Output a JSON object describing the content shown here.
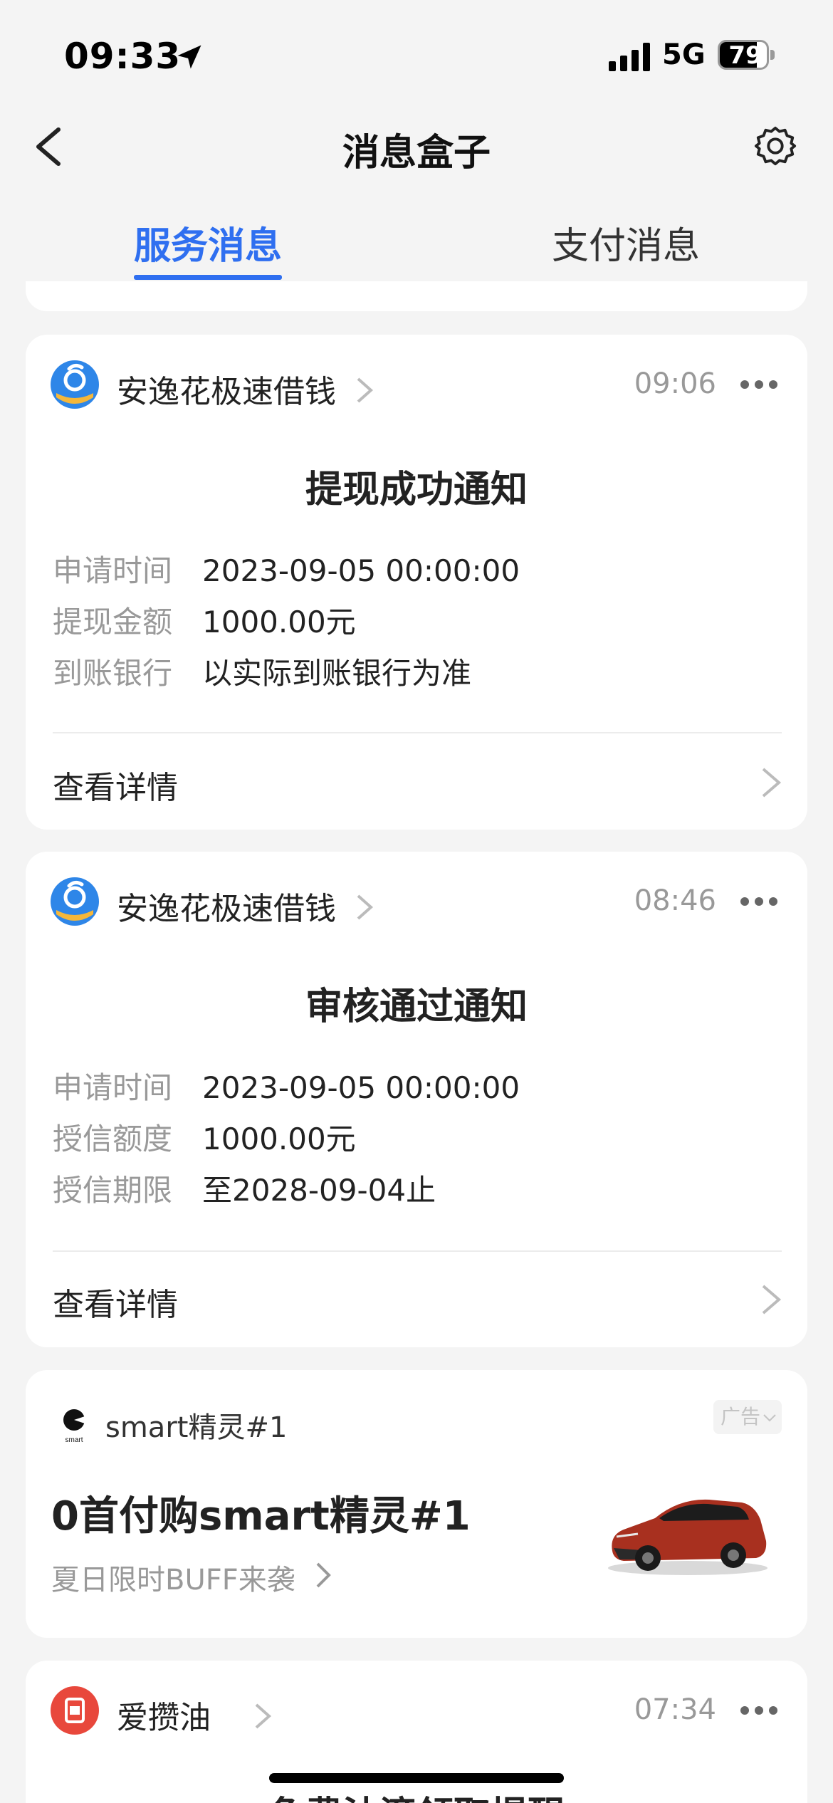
{
  "status_bar": {
    "time": "09:33",
    "network": "5G",
    "battery": "79",
    "battery_level": 0.79
  },
  "nav": {
    "title": "消息盒子"
  },
  "tabs": [
    {
      "label": "服务消息",
      "active": true
    },
    {
      "label": "支付消息",
      "active": false
    }
  ],
  "messages": [
    {
      "app": "安逸花极速借钱",
      "time": "09:06",
      "title": "提现成功通知",
      "rows": [
        {
          "key": "申请时间",
          "value": "2023-09-05 00:00:00"
        },
        {
          "key": "提现金额",
          "value": "1000.00元"
        },
        {
          "key": "到账银行",
          "value": "以实际到账银行为准"
        }
      ],
      "link": "查看详情"
    },
    {
      "app": "安逸花极速借钱",
      "time": "08:46",
      "title": "审核通过通知",
      "rows": [
        {
          "key": "申请时间",
          "value": "2023-09-05 00:00:00"
        },
        {
          "key": "授信额度",
          "value": "1000.00元"
        },
        {
          "key": "授信期限",
          "value": "至2028-09-04止"
        }
      ],
      "link": "查看详情"
    },
    {
      "app": "爱攒油",
      "time": "07:34",
      "title": "免费油滴领取提醒"
    }
  ],
  "ad": {
    "brand": "smart精灵#1",
    "logo_text": "smart",
    "badge": "广告",
    "title": "0首付购smart精灵#1",
    "subtitle": "夏日限时BUFF来袭"
  },
  "colors": {
    "accent": "#2f6ff0",
    "background": "#f4f4f4",
    "card": "#ffffff",
    "muted": "#999999"
  }
}
